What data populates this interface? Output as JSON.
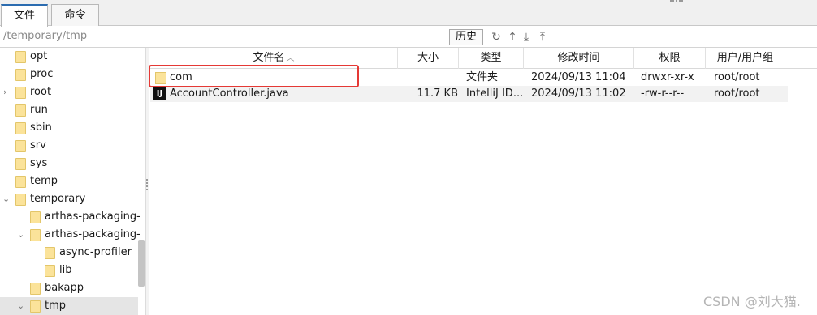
{
  "tabs": [
    {
      "label": "文件"
    },
    {
      "label": "命令"
    }
  ],
  "pathbar": {
    "path": "/temporary/tmp",
    "history_label": "历史"
  },
  "toolbar_icons": [
    "refresh-icon",
    "go-up-icon",
    "download-icon",
    "upload-icon"
  ],
  "tree": {
    "items": [
      {
        "label": "opt"
      },
      {
        "label": "proc"
      },
      {
        "label": "root"
      },
      {
        "label": "run"
      },
      {
        "label": "sbin"
      },
      {
        "label": "srv"
      },
      {
        "label": "sys"
      },
      {
        "label": "temp"
      },
      {
        "label": "temporary"
      },
      {
        "label": "arthas-packaging-"
      },
      {
        "label": "arthas-packaging-"
      },
      {
        "label": "async-profiler"
      },
      {
        "label": "lib"
      },
      {
        "label": "bakapp"
      },
      {
        "label": "tmp"
      }
    ]
  },
  "columns": {
    "name": "文件名",
    "size": "大小",
    "type": "类型",
    "modified": "修改时间",
    "perm": "权限",
    "owner": "用户/用户组"
  },
  "files": [
    {
      "name": "com",
      "size": "",
      "type": "文件夹",
      "modified": "2024/09/13 11:04",
      "perm": "drwxr-xr-x",
      "owner": "root/root",
      "icon": "folder-icon"
    },
    {
      "name": "AccountController.java",
      "size": "11.7 KB",
      "type": "IntelliJ ID...",
      "modified": "2024/09/13 11:02",
      "perm": "-rw-r--r--",
      "owner": "root/root",
      "icon": "intellij-file-icon"
    }
  ],
  "watermark": "CSDN @刘大猫.",
  "colors": {
    "highlight": "#e53935",
    "folder": "#fbe39a",
    "tab_accent": "#2b6cb0"
  }
}
